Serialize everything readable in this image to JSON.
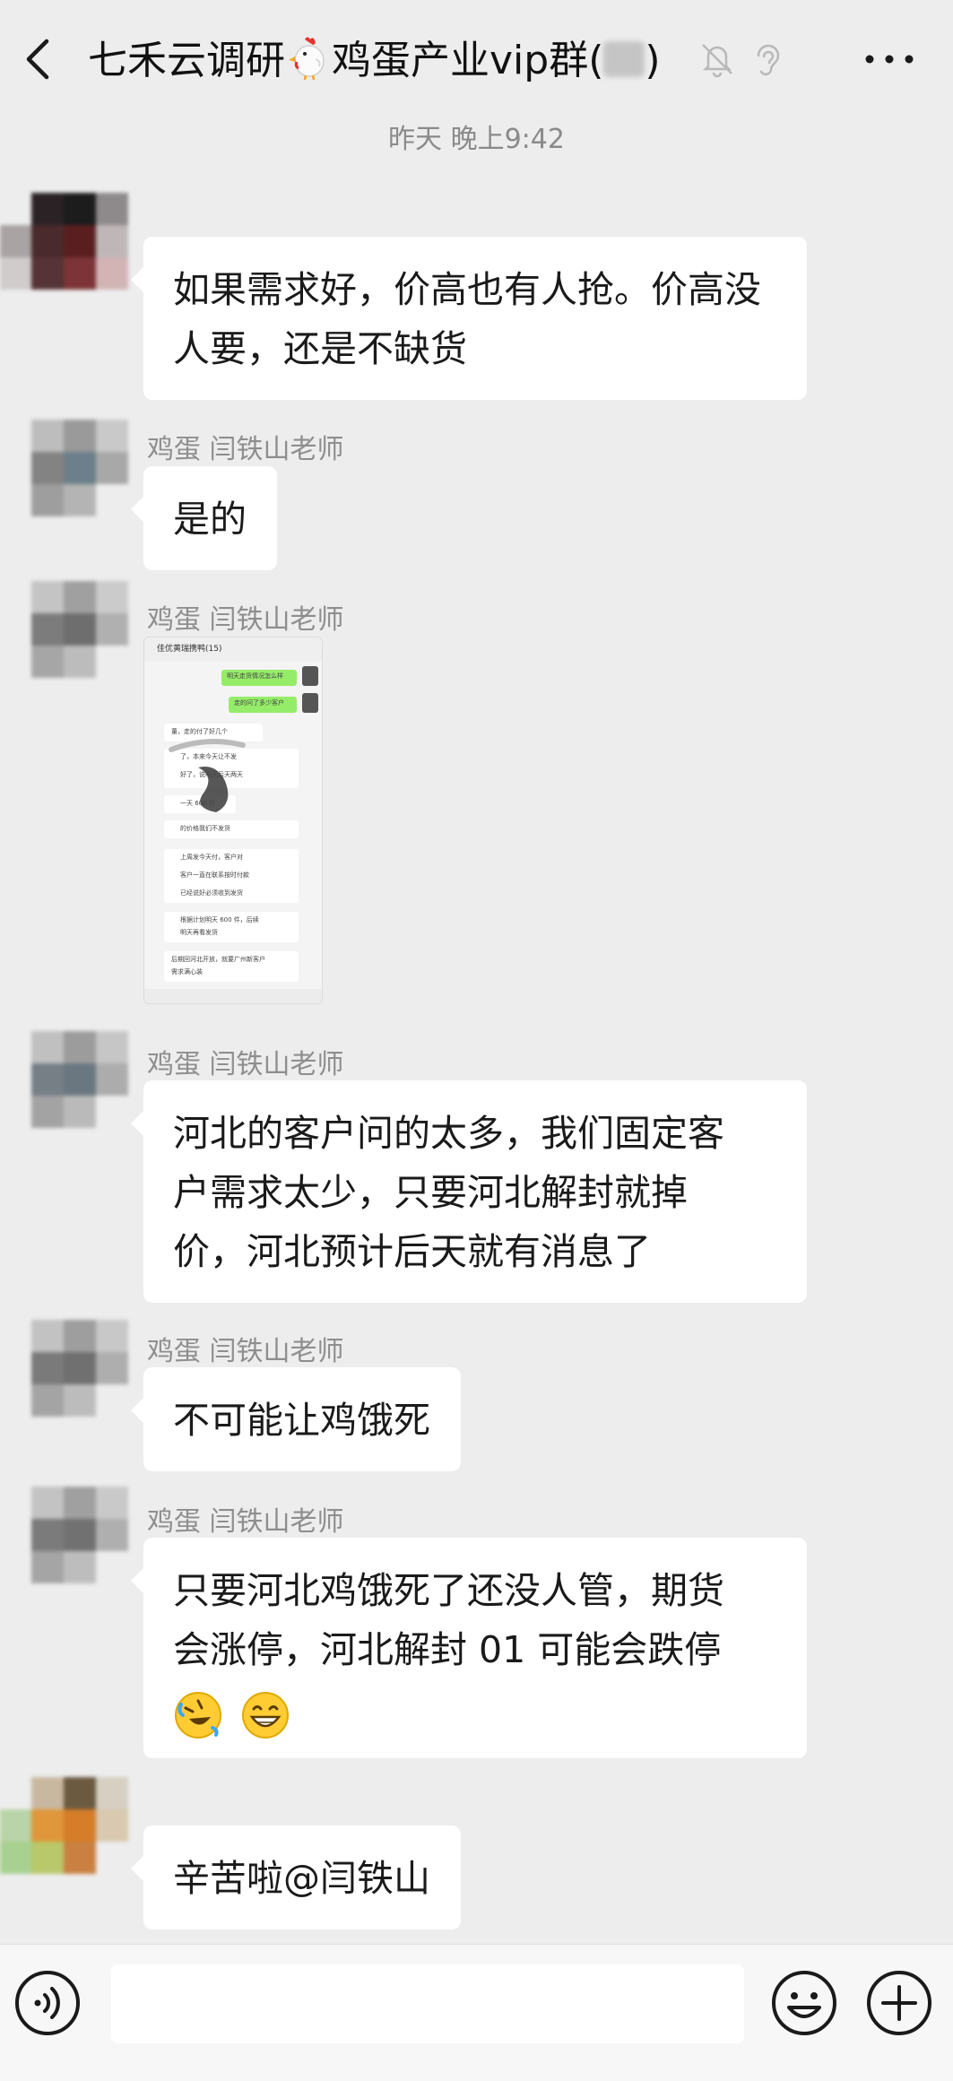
{
  "header": {
    "title_prefix": "七禾云调研",
    "title_suffix": "鸡蛋产业vip群(",
    "title_close": ")"
  },
  "timestamp": "昨天 晚上9:42",
  "messages": [
    {
      "sender": "",
      "text": "如果需求好，价高也有人抢。价高没人要，还是不缺货"
    },
    {
      "sender": "鸡蛋 闫铁山老师",
      "text": "是的"
    },
    {
      "sender": "鸡蛋 闫铁山老师",
      "image": true,
      "image_header": "佳优黄瑞携鸭(15)",
      "image_lines": [
        "明天走货情况怎么样",
        "走的问了多少客户",
        "董，走的付了好几个",
        "了，本来今天让不发",
        "好了，说明天后天两天",
        "一天 600 件",
        "的价格我们不发货",
        "上周发今天付，客户对",
        "客户一直在联系按时付款",
        "已经说好必须收到发货",
        "根据计划明天 600 件，后续",
        "明天再看发货",
        "后期回河北开放，就要广州新客户",
        "需求满心装"
      ]
    },
    {
      "sender": "鸡蛋 闫铁山老师",
      "text_lines": [
        "河北的客户问的太多，我们固定客",
        "户需求太少，只要河北解封就掉",
        "价，河北预计后天就有消息了"
      ]
    },
    {
      "sender": "鸡蛋 闫铁山老师",
      "text": "不可能让鸡饿死"
    },
    {
      "sender": "鸡蛋 闫铁山老师",
      "text_lines": [
        "只要河北鸡饿死了还没人管，期货",
        "会涨停，河北解封 01 可能会跌停"
      ]
    },
    {
      "sender": "",
      "text": "辛苦啦@闫铁山"
    }
  ],
  "input": {
    "placeholder": ""
  },
  "icons": {
    "back": "chevron-left-icon",
    "title_emoji": "chicken-icon",
    "mute": "bell-mute-icon",
    "ear": "ear-icon",
    "more": "more-dots-icon",
    "voice": "voice-icon",
    "emoji": "emoji-icon",
    "plus": "plus-icon"
  },
  "colors": {
    "background": "#ededed",
    "bubble": "#ffffff",
    "muted_text": "#8e8e8e"
  }
}
